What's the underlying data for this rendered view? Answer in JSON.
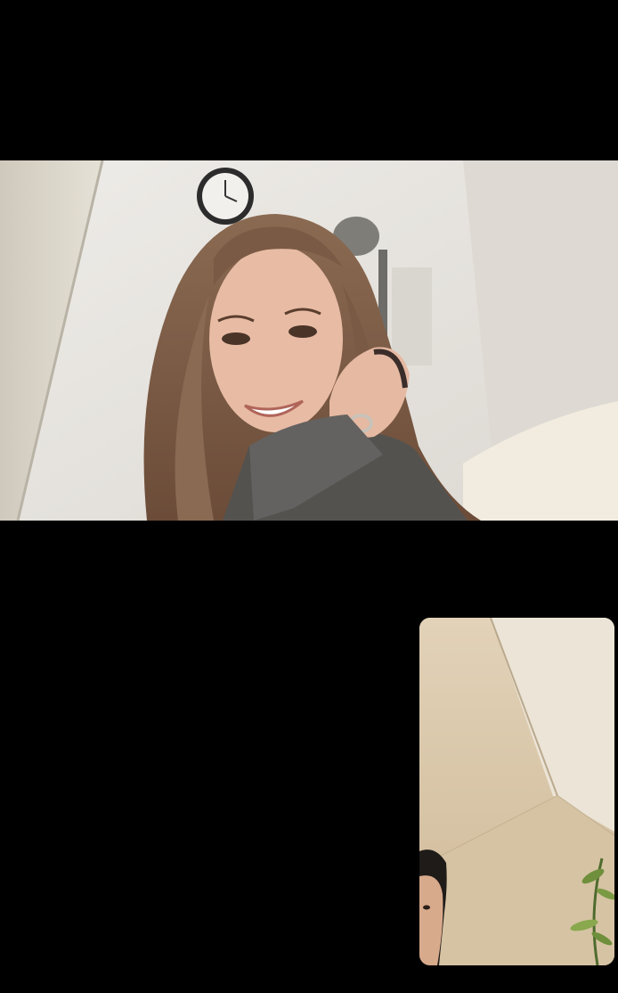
{
  "call": {
    "remote_participant_feed": "remote-video",
    "self_feed": "self-view"
  },
  "colors": {
    "background": "#000000",
    "remote_wall": "#e9e6e1",
    "self_wall": "#d8c8ae"
  }
}
